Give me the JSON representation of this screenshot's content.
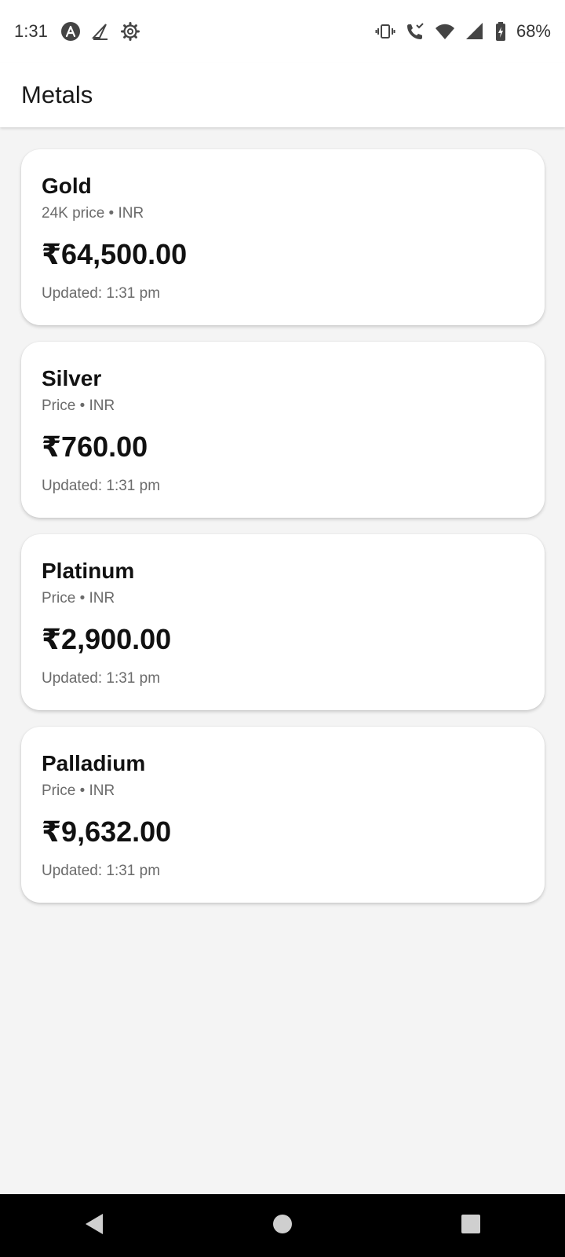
{
  "status_bar": {
    "time": "1:31",
    "battery": "68%",
    "left_icons": [
      "app-a-icon",
      "kite-icon",
      "settings-icon"
    ],
    "right_icons": [
      "vibrate-icon",
      "wifi-calling-icon",
      "wifi-icon",
      "signal-icon",
      "battery-icon"
    ]
  },
  "app_bar": {
    "title": "Metals"
  },
  "metals": [
    {
      "name": "Gold",
      "subtitle": "24K price • INR",
      "price": "₹64,500.00",
      "updated": "Updated: 1:31 pm"
    },
    {
      "name": "Silver",
      "subtitle": "Price • INR",
      "price": "₹760.00",
      "updated": "Updated: 1:31 pm"
    },
    {
      "name": "Platinum",
      "subtitle": "Price • INR",
      "price": "₹2,900.00",
      "updated": "Updated: 1:31 pm"
    },
    {
      "name": "Palladium",
      "subtitle": "Price • INR",
      "price": "₹9,632.00",
      "updated": "Updated: 1:31 pm"
    }
  ],
  "nav_bar": {
    "buttons": [
      "back-icon",
      "home-icon",
      "recents-icon"
    ]
  },
  "colors": {
    "background": "#f4f4f4",
    "card": "#ffffff",
    "text_primary": "#111111",
    "text_secondary": "#6b6b6b",
    "nav_bar": "#000000"
  }
}
